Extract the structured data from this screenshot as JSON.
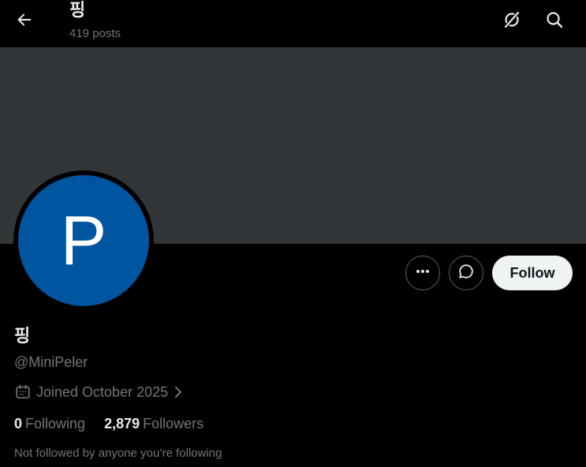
{
  "header": {
    "title": "핑",
    "posts_count": "419 posts"
  },
  "profile": {
    "avatar_letter": "P",
    "name": "핑",
    "handle": "@MiniPeler",
    "joined": "Joined October 2025",
    "following_count": "0",
    "following_label": "Following",
    "followers_count": "2,879",
    "followers_label": "Followers",
    "not_followed_text": "Not followed by anyone you’re following"
  },
  "actions": {
    "follow_label": "Follow"
  },
  "icons": {
    "back": "arrow-left-icon",
    "grok": "grok-icon",
    "search": "search-icon",
    "more": "more-dots-icon",
    "chat": "message-icon",
    "calendar": "calendar-icon",
    "chevron": "chevron-right-icon"
  },
  "colors": {
    "banner": "#333639",
    "avatar": "#0055a0",
    "follow_button_bg": "#eff3f4",
    "secondary_text": "#71767b"
  }
}
